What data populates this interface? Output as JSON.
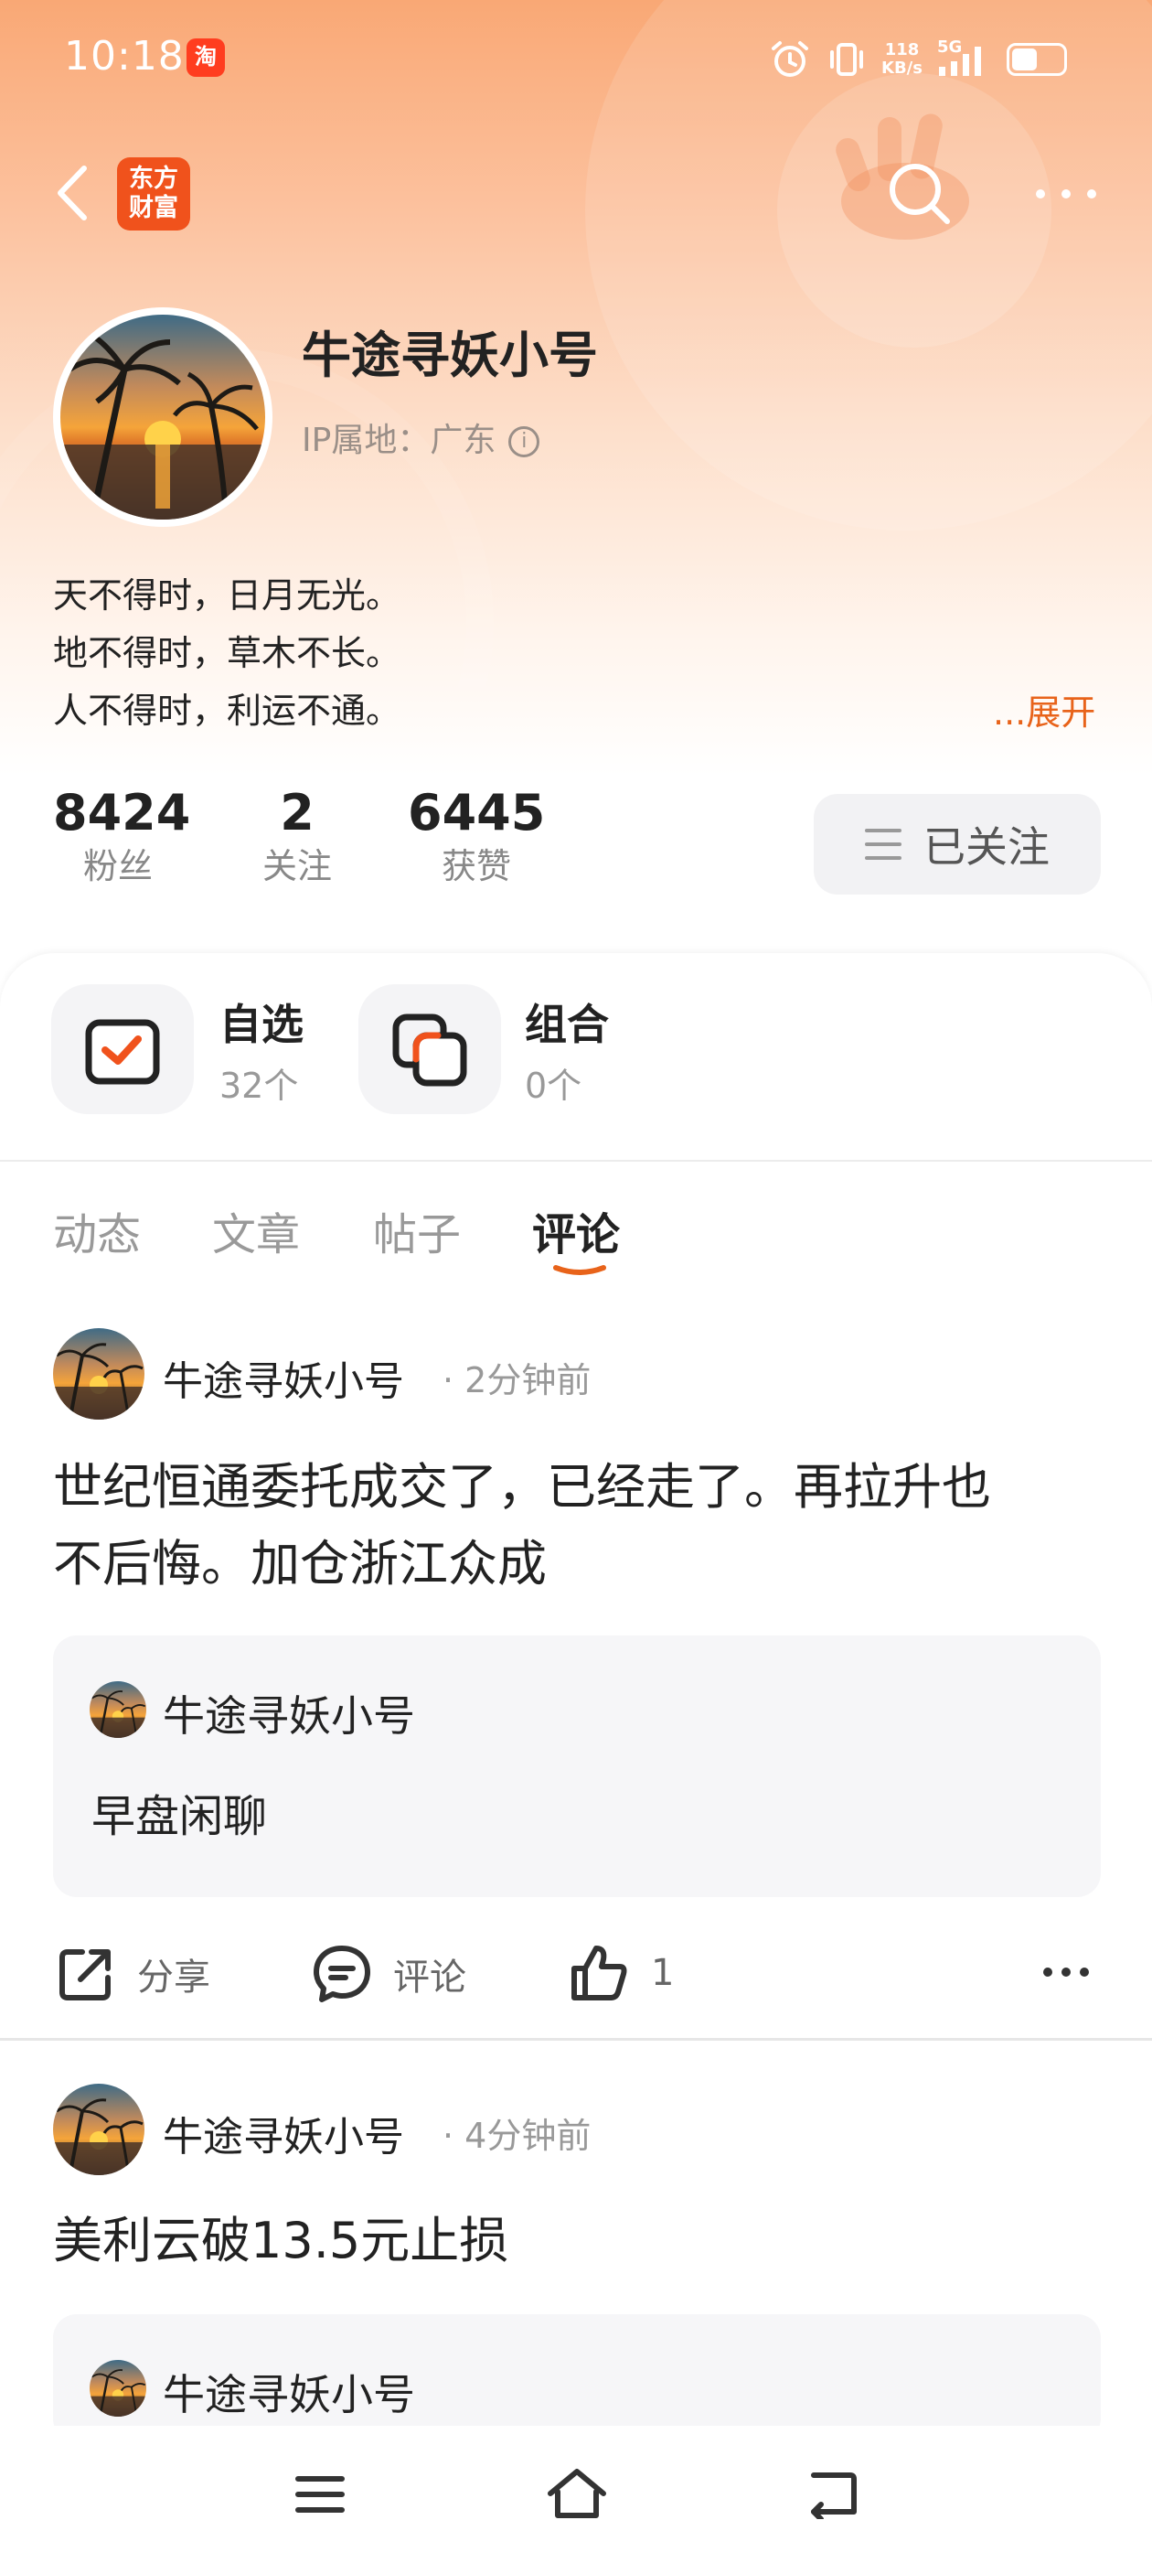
{
  "status_bar": {
    "time": "10:18",
    "app_badge": "淘",
    "net_speed_value": "118",
    "net_speed_unit": "KB/s",
    "network_type": "5G",
    "battery_level": 0.55
  },
  "header": {
    "logo_line1": "东方",
    "logo_line2": "财富"
  },
  "profile": {
    "username": "牛途寻妖小号",
    "ip_location": "IP属地：广东",
    "bio_lines": [
      "天不得时，日月无光。",
      "地不得时，草木不长。",
      "人不得时，利运不通。"
    ],
    "expand_label": "...展开"
  },
  "stats": [
    {
      "value": "8424",
      "label": "粉丝"
    },
    {
      "value": "2",
      "label": "关注"
    },
    {
      "value": "6445",
      "label": "获赞"
    }
  ],
  "follow_button": {
    "label": "已关注"
  },
  "shortcuts": [
    {
      "title": "自选",
      "count": "32个"
    },
    {
      "title": "组合",
      "count": "0个"
    }
  ],
  "tabs": [
    {
      "label": "动态",
      "active": false
    },
    {
      "label": "文章",
      "active": false
    },
    {
      "label": "帖子",
      "active": false
    },
    {
      "label": "评论",
      "active": true
    }
  ],
  "posts": [
    {
      "author": "牛途寻妖小号",
      "time": "2分钟前",
      "text_line1": "世纪恒通委托成交了，已经走了。再拉升也",
      "text_line2": "不后悔。加仓浙江众成",
      "quote_author": "牛途寻妖小号",
      "quote_text": "早盘闲聊",
      "share_label": "分享",
      "comment_label": "评论",
      "like_count": "1"
    },
    {
      "author": "牛途寻妖小号",
      "time": "4分钟前",
      "text_line1": "美利云破13.5元止损",
      "quote_author": "牛途寻妖小号"
    }
  ],
  "colors": {
    "accent": "#e8631a",
    "header_top": "#f9a875",
    "brand_logo": "#f0521c"
  }
}
